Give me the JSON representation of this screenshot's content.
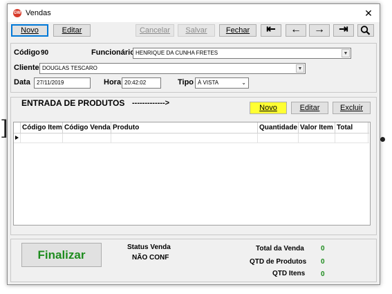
{
  "window": {
    "title": "Vendas",
    "icon_text": "GW",
    "close_glyph": "✕"
  },
  "toolbar": {
    "novo": "Novo",
    "editar": "Editar",
    "cancelar": "Cancelar",
    "salvar": "Salvar",
    "fechar": "Fechar",
    "nav_first": "⇤",
    "nav_prev": "←",
    "nav_next": "→",
    "nav_last": "⇥"
  },
  "header": {
    "codigo_label": "Código",
    "codigo_value": "90",
    "funcionario_label": "Funcionário",
    "funcionario_value": "HENRIQUE DA CUNHA FRETES",
    "cliente_label": "Cliente",
    "cliente_value": "DOUGLAS TESCARO",
    "data_label": "Data",
    "data_value": "27/11/2019",
    "hora_label": "Hora",
    "hora_value": "20:42:02",
    "tipo_label": "Tipo",
    "tipo_value": "À VISTA"
  },
  "produtos": {
    "title": "ENTRADA DE PRODUTOS",
    "arrow": "------------->",
    "novo": "Novo",
    "editar": "Editar",
    "excluir": "Excluir",
    "columns": [
      "Código Item",
      "Código Venda",
      "Produto",
      "Quantidade",
      "Valor Item",
      "Total"
    ]
  },
  "footer": {
    "finalizar": "Finalizar",
    "status_label": "Status Venda",
    "status_value": "NÃO CONF",
    "total_venda_label": "Total da Venda",
    "total_venda_value": "0",
    "qtd_produtos_label": "QTD de Produtos",
    "qtd_produtos_value": "0",
    "qtd_itens_label": "QTD Itens",
    "qtd_itens_value": "0"
  },
  "colors": {
    "accent": "#0078d7",
    "highlight": "#ffff33",
    "green": "#1e8c1e"
  }
}
